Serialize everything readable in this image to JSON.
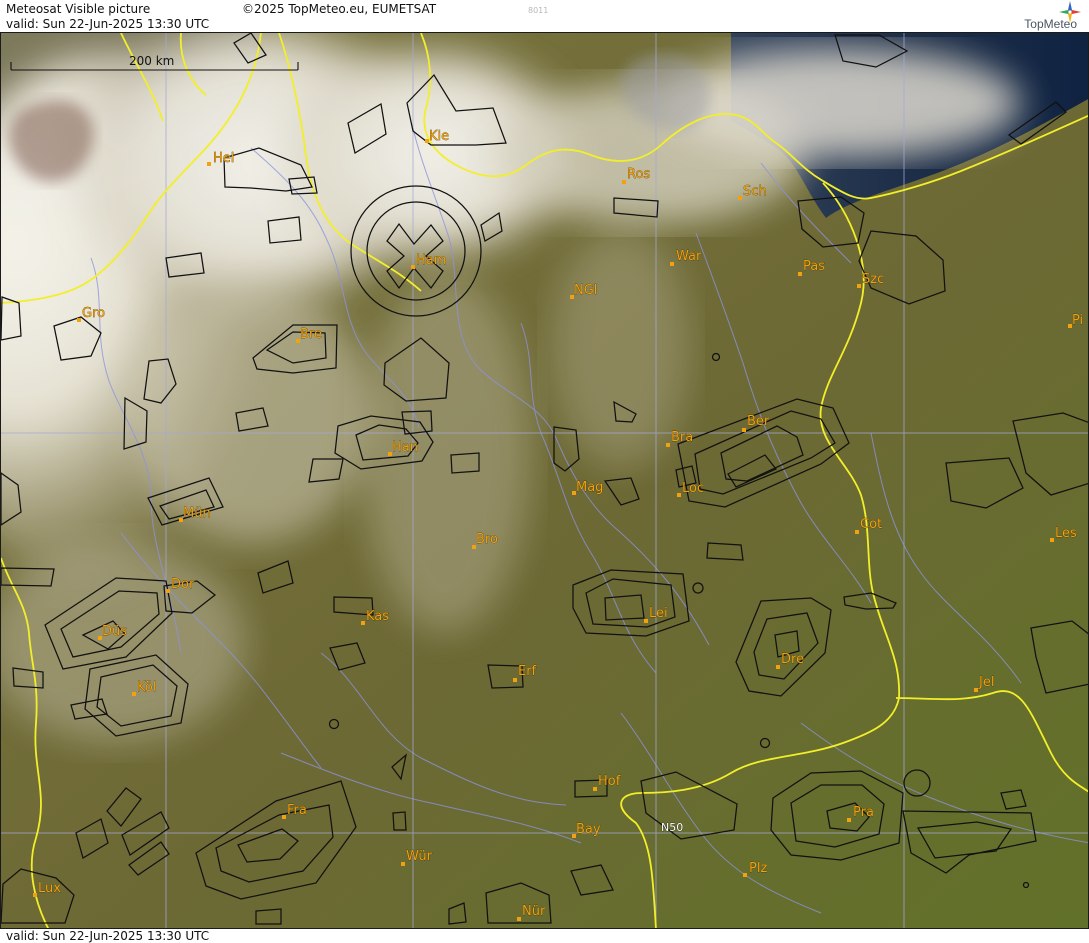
{
  "header": {
    "title": "Meteosat Visible picture",
    "copyright": "©2025 TopMeteo.eu, EUMETSAT",
    "code": "8011",
    "valid_text": "valid:  Sun  22-Jun-2025  13:30 UTC",
    "brand": "TopMeteo"
  },
  "footer": {
    "valid_text": "valid:  Sun  22-Jun-2025  13:30 UTC"
  },
  "scale": {
    "label": "200 km"
  },
  "grid_label": "N50",
  "cities": [
    {
      "name": "Hel",
      "icon": "city-marker-icon"
    },
    {
      "name": "Kie",
      "icon": "city-marker-icon"
    },
    {
      "name": "Ros",
      "icon": "city-marker-icon"
    },
    {
      "name": "Sch",
      "icon": "city-marker-icon"
    },
    {
      "name": "War",
      "icon": "city-marker-icon"
    },
    {
      "name": "Pas",
      "icon": "city-marker-icon"
    },
    {
      "name": "Szc",
      "icon": "city-marker-icon"
    },
    {
      "name": "Ham",
      "icon": "city-marker-icon"
    },
    {
      "name": "NGl",
      "icon": "city-marker-icon"
    },
    {
      "name": "Gro",
      "icon": "city-marker-icon"
    },
    {
      "name": "Bre",
      "icon": "city-marker-icon"
    },
    {
      "name": "Pi",
      "icon": "city-marker-icon"
    },
    {
      "name": "Ber",
      "icon": "city-marker-icon"
    },
    {
      "name": "Bra",
      "icon": "city-marker-icon"
    },
    {
      "name": "Han",
      "icon": "city-marker-icon"
    },
    {
      "name": "Mag",
      "icon": "city-marker-icon"
    },
    {
      "name": "Loc",
      "icon": "city-marker-icon"
    },
    {
      "name": "Mün",
      "icon": "city-marker-icon"
    },
    {
      "name": "Cot",
      "icon": "city-marker-icon"
    },
    {
      "name": "Les",
      "icon": "city-marker-icon"
    },
    {
      "name": "Bro",
      "icon": "city-marker-icon"
    },
    {
      "name": "Dor",
      "icon": "city-marker-icon"
    },
    {
      "name": "Kas",
      "icon": "city-marker-icon"
    },
    {
      "name": "Lei",
      "icon": "city-marker-icon"
    },
    {
      "name": "Düs",
      "icon": "city-marker-icon"
    },
    {
      "name": "Dre",
      "icon": "city-marker-icon"
    },
    {
      "name": "Erf",
      "icon": "city-marker-icon"
    },
    {
      "name": "Köl",
      "icon": "city-marker-icon"
    },
    {
      "name": "Jel",
      "icon": "city-marker-icon"
    },
    {
      "name": "Hof",
      "icon": "city-marker-icon"
    },
    {
      "name": "Fra",
      "icon": "city-marker-icon"
    },
    {
      "name": "Bay",
      "icon": "city-marker-icon"
    },
    {
      "name": "Pra",
      "icon": "city-marker-icon"
    },
    {
      "name": "Wür",
      "icon": "city-marker-icon"
    },
    {
      "name": "Plz",
      "icon": "city-marker-icon"
    },
    {
      "name": "Lux",
      "icon": "city-marker-icon"
    },
    {
      "name": "Nür",
      "icon": "city-marker-icon"
    }
  ],
  "colors": {
    "land": "#6e6a35",
    "sea": "#1f314a",
    "cloud": "#eeece2",
    "border": "#f2ef2a",
    "river": "#8c93dd",
    "airspace": "#111111",
    "city_label": "#f2a10f",
    "grid": "#a4a8d6"
  }
}
